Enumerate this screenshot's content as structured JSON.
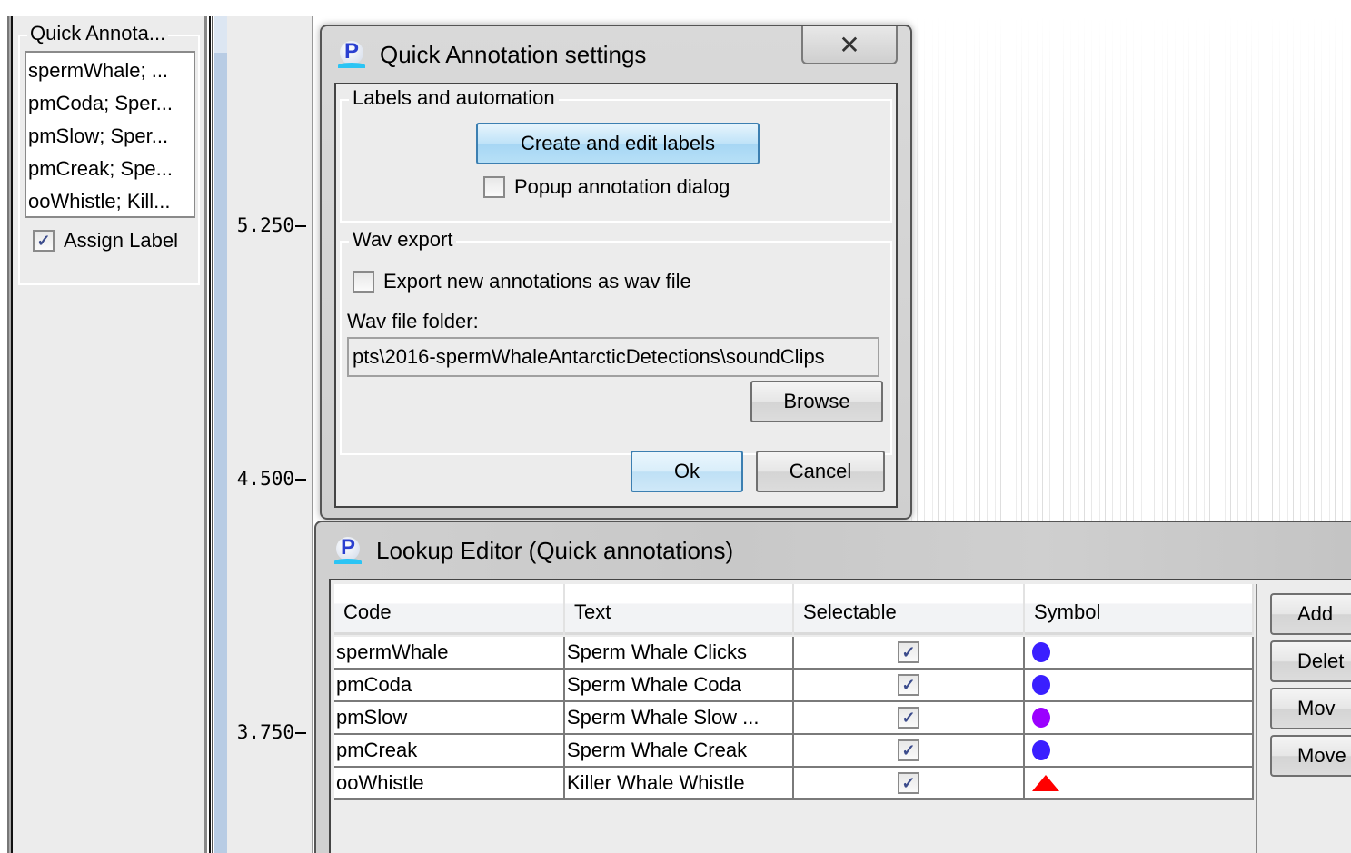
{
  "sidebar": {
    "group_title": "Quick Annota...",
    "list_items": [
      "spermWhale; ...",
      "pmCoda; Sper...",
      "pmSlow; Sper...",
      "pmCreak; Spe...",
      "ooWhistle; Kill..."
    ],
    "assign_label": "Assign Label",
    "assign_checked": true
  },
  "axis": {
    "ticks": [
      "5.250",
      "4.500",
      "3.750"
    ]
  },
  "settings_dialog": {
    "title": "Quick Annotation settings",
    "close_icon": "close-icon",
    "labels_group": {
      "title": "Labels and automation",
      "create_button": "Create and edit labels",
      "popup_label": "Popup annotation dialog",
      "popup_checked": false
    },
    "wav_group": {
      "title": "Wav export",
      "export_label": "Export new annotations as wav file",
      "export_checked": false,
      "folder_label": "Wav file folder:",
      "folder_value": "pts\\2016-spermWhaleAntarcticDetections\\soundClips",
      "browse_button": "Browse"
    },
    "ok_button": "Ok",
    "cancel_button": "Cancel"
  },
  "lookup_editor": {
    "title": "Lookup Editor (Quick annotations)",
    "columns": [
      "Code",
      "Text",
      "Selectable",
      "Symbol"
    ],
    "rows": [
      {
        "code": "spermWhale",
        "text": "Sperm Whale Clicks",
        "selectable": true,
        "symbol": "circle",
        "color": "#3a1fff"
      },
      {
        "code": "pmCoda",
        "text": "Sperm Whale Coda",
        "selectable": true,
        "symbol": "circle",
        "color": "#3a1fff"
      },
      {
        "code": "pmSlow",
        "text": "Sperm Whale Slow ...",
        "selectable": true,
        "symbol": "circle",
        "color": "#9b00ff"
      },
      {
        "code": "pmCreak",
        "text": "Sperm Whale Creak",
        "selectable": true,
        "symbol": "circle",
        "color": "#3a1fff"
      },
      {
        "code": "ooWhistle",
        "text": "Killer Whale Whistle",
        "selectable": true,
        "symbol": "triangle",
        "color": "#ff0000"
      }
    ],
    "side_buttons": [
      "Add",
      "Delete",
      "Move up",
      "Move down"
    ],
    "side_buttons_visible": [
      "Add",
      "Delet",
      "Mov",
      "Move"
    ]
  },
  "check_glyph": "✓"
}
